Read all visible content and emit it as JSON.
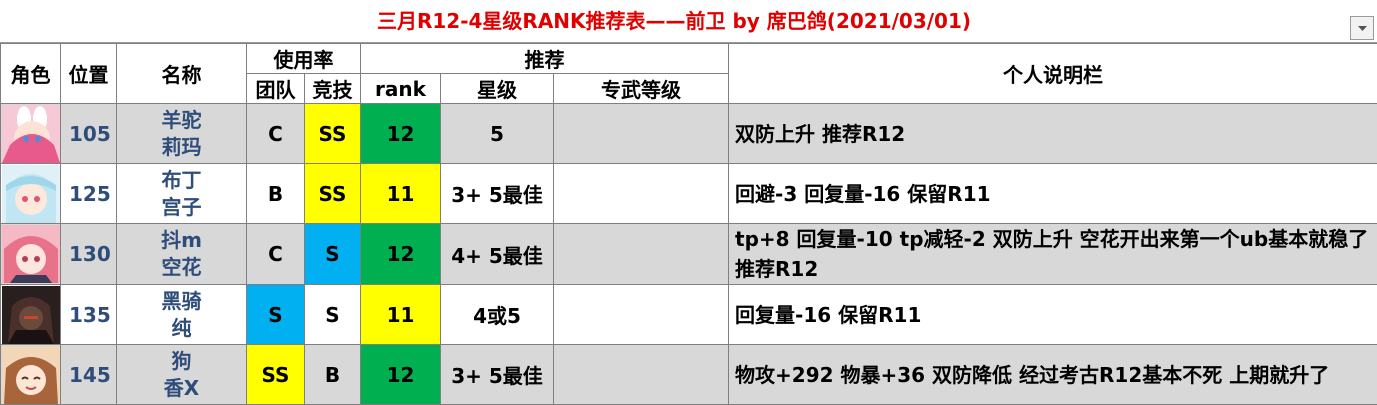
{
  "title": "三月R12-4星级RANK推荐表——前卫  by  席巴鸽(2021/03/01)",
  "headers": {
    "role": "角色",
    "position": "位置",
    "name": "名称",
    "usage": "使用率",
    "usage_team": "团队",
    "usage_arena": "竞技",
    "recommend": "推荐",
    "rec_rank": "rank",
    "rec_star": "星级",
    "rec_ue": "专武等级",
    "notes": "个人说明栏"
  },
  "colors": {
    "title": "#e00000",
    "name_text": "#2e4d7a",
    "yellow": "#ffff00",
    "blue": "#00b0f0",
    "green": "#00b050",
    "row_gray": "#d8d8d8"
  },
  "rows": [
    {
      "position": "105",
      "name_line1": "羊驼",
      "name_line2": "莉玛",
      "team": "C",
      "arena": "SS",
      "rank": "12",
      "star": "5",
      "ue": "",
      "notes": "双防上升 推荐R12"
    },
    {
      "position": "125",
      "name_line1": "布丁",
      "name_line2": "宫子",
      "team": "B",
      "arena": "SS",
      "rank": "11",
      "star": "3+ 5最佳",
      "ue": "",
      "notes": "回避-3 回复量-16 保留R11"
    },
    {
      "position": "130",
      "name_line1": "抖m",
      "name_line2": "空花",
      "team": "C",
      "arena": "S",
      "rank": "12",
      "star": "4+ 5最佳",
      "ue": "",
      "notes": "tp+8 回复量-10 tp减轻-2 双防上升 空花开出来第一个ub基本就稳了 推荐R12"
    },
    {
      "position": "135",
      "name_line1": "黑骑",
      "name_line2": "纯",
      "team": "S",
      "arena": "S",
      "rank": "11",
      "star": "4或5",
      "ue": "",
      "notes": "回复量-16 保留R11"
    },
    {
      "position": "145",
      "name_line1": "狗",
      "name_line2": "香X",
      "team": "SS",
      "arena": "B",
      "rank": "12",
      "star": "3+ 5最佳",
      "ue": "",
      "notes": "物攻+292 物暴+36 双防降低 经过考古R12基本不死 上期就升了"
    }
  ]
}
